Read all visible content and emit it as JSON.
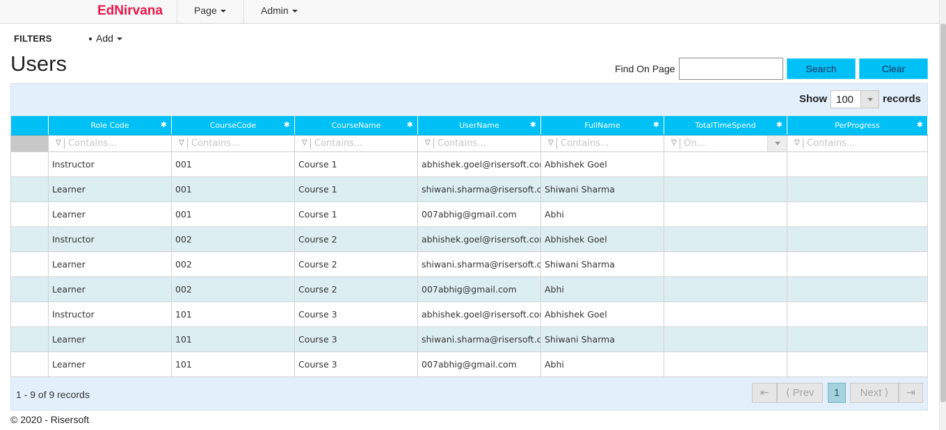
{
  "nav": {
    "brand": "EdNirvana",
    "items": [
      {
        "label": "Page"
      },
      {
        "label": "Admin"
      }
    ]
  },
  "filters": {
    "label": "FILTERS",
    "add_label": "Add"
  },
  "page_title": "Users",
  "find": {
    "label": "Find On Page",
    "value": "",
    "search_label": "Search",
    "clear_label": "Clear"
  },
  "show": {
    "label": "Show",
    "value": "100",
    "suffix": "records"
  },
  "columns": [
    "Role Code",
    "CourseCode",
    "CourseName",
    "UserName",
    "FullName",
    "TotalTimeSpend",
    "PerProgress"
  ],
  "filter_placeholders": [
    "Contains...",
    "Contains...",
    "Contains...",
    "Contains...",
    "Contains...",
    "On...",
    "Contains..."
  ],
  "rows": [
    [
      "Instructor",
      "001",
      "Course 1",
      "abhishek.goel@risersoft.com",
      "Abhishek Goel",
      "",
      ""
    ],
    [
      "Learner",
      "001",
      "Course 1",
      "shiwani.sharma@risersoft.com",
      "Shiwani Sharma",
      "",
      ""
    ],
    [
      "Learner",
      "001",
      "Course 1",
      "007abhig@gmail.com",
      "Abhi",
      "",
      ""
    ],
    [
      "Instructor",
      "002",
      "Course 2",
      "abhishek.goel@risersoft.com",
      "Abhishek Goel",
      "",
      ""
    ],
    [
      "Learner",
      "002",
      "Course 2",
      "shiwani.sharma@risersoft.com",
      "Shiwani Sharma",
      "",
      ""
    ],
    [
      "Learner",
      "002",
      "Course 2",
      "007abhig@gmail.com",
      "Abhi",
      "",
      ""
    ],
    [
      "Instructor",
      "101",
      "Course 3",
      "abhishek.goel@risersoft.com",
      "Abhishek Goel",
      "",
      ""
    ],
    [
      "Learner",
      "101",
      "Course 3",
      "shiwani.sharma@risersoft.com",
      "Shiwani Sharma",
      "",
      ""
    ],
    [
      "Learner",
      "101",
      "Course 3",
      "007abhig@gmail.com",
      "Abhi",
      "",
      ""
    ]
  ],
  "pager": {
    "summary": "1 - 9 of 9 records",
    "first": "⇤",
    "prev": "Prev",
    "current": "1",
    "next": "Next",
    "last": "⇥"
  },
  "footer": "© 2020 - Risersoft",
  "colors": {
    "brand": "#e8174a",
    "accent": "#00c0f6",
    "row_alt": "#ddeef3",
    "grid_bg": "#e3f0fb"
  }
}
